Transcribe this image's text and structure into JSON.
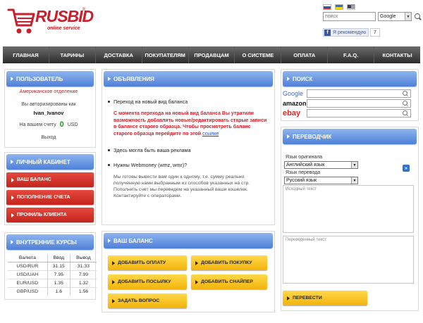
{
  "header": {
    "logo_text": "RUSBID",
    "logo_tagline": "online service",
    "logo_reg": "®",
    "flags": [
      "flag-ru-icon",
      "flag-ua-icon",
      "flag-us-icon"
    ],
    "search": {
      "placeholder": "поиск",
      "engine": "Google"
    },
    "facebook": {
      "like_label": "Я рекомендую",
      "count": "7"
    }
  },
  "nav": [
    "ГЛАВНАЯ",
    "ТАРИФЫ",
    "ДОСТАВКА",
    "ПОКУПАТЕЛЯМ",
    "ПРОДАВЦАМ",
    "О СИСТЕМЕ",
    "ОПЛАТА",
    "F.A.Q.",
    "КОНТАКТЫ"
  ],
  "user_panel": {
    "title": "ПОЛЬЗОВАТЕЛЬ",
    "department": "Американское отделение",
    "auth_text": "Вы авторизированы как",
    "username": "Ivan_Ivanov",
    "balance_label": "На вашем счету",
    "balance_value": "0",
    "balance_currency": "USD",
    "logout": "Выход"
  },
  "cabinet": {
    "title": "ЛИЧНЫЙ КАБИНЕТ",
    "items": [
      "ВАШ БАЛАНС",
      "ПОПОЛНЕНИЕ СЧЕТА",
      "ПРОФИЛЬ КЛИЕНТА"
    ]
  },
  "rates": {
    "title": "ВНУТРЕННИЕ КУРСЫ",
    "headers": [
      "Валюта",
      "Ввод",
      "Вывод"
    ],
    "rows": [
      [
        "USD/RUR",
        "31.15",
        "31.33"
      ],
      [
        "USD/UAH",
        "7.95",
        "7.99"
      ],
      [
        "EUR/USD",
        "1.35",
        "1.32"
      ],
      [
        "GBP/USD",
        "1.6",
        "1.56"
      ]
    ]
  },
  "announcements": {
    "title": "ОБЪЯВЛЕНИЯ",
    "item1": "Переход на новый вид баланса",
    "red_text": "С момента перехода на новый вид баланса Вы утратили возможность добавлять новые/редактировать старые записи в балансе старого образца. Чтобы просмотреть баланс старого образца перейдите по этой",
    "red_link": "ссылке",
    "item2": "Здесь могла быть ваша реклама",
    "item3": "Нужны Webmoney (wmz, wmr)?",
    "gray_text": "Мы готовы вывести вам один к одному, т.е. сумму реально полученную нами выбранным из способов указанных на стр. Пополнить счет мы переведем на указанный ваши кошелек. Контактируйте с операторами."
  },
  "balance_panel": {
    "title": "ВАШ БАЛАНС",
    "buttons": [
      "ДОБАВИТЬ ОПЛАТУ",
      "ДОБАВИТЬ ПОКУПКУ",
      "ДОБАВИТЬ ПОСЫЛКУ",
      "ДОБАВИТЬ СНАЙПЕР",
      "ЗАДАТЬ ВОПРОС"
    ]
  },
  "search_panel": {
    "title": "ПОИСК",
    "engines": [
      "Google",
      "amazon",
      "ebay"
    ]
  },
  "translator": {
    "title": "ПЕРЕВОДЧИК",
    "source_label": "Язык оригинала",
    "source_value": "Английский язык",
    "target_label": "Язык перевода",
    "target_value": "Русский язык",
    "source_placeholder": "Исходный текст",
    "target_placeholder": "Переведенный текст",
    "translate_button": "ПЕРЕВЕСТИ"
  },
  "colors": {
    "brand_red": "#c8202c",
    "panel_blue": "#4f80d8",
    "nav_dark": "#2c2c2c",
    "button_red": "#c4241c",
    "button_yellow": "#f3b30c",
    "positive_green": "#1a9a1a"
  }
}
